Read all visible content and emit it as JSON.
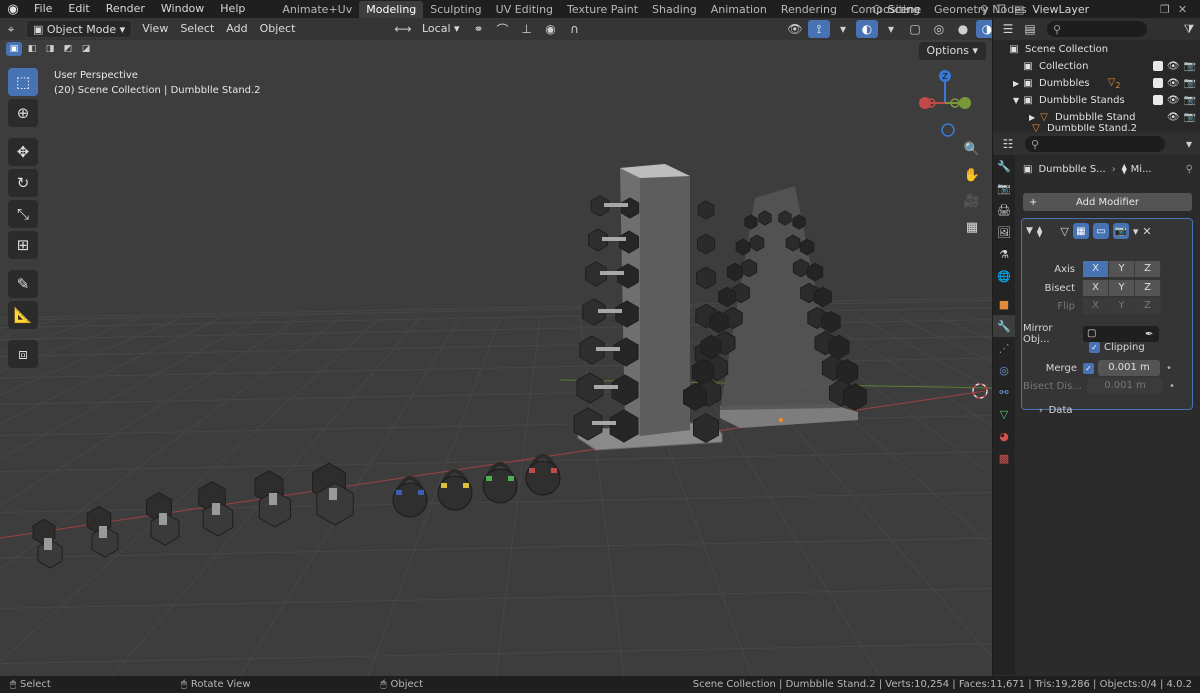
{
  "menu": [
    "File",
    "Edit",
    "Render",
    "Window",
    "Help"
  ],
  "workspaces": [
    {
      "label": "Animate+Uv",
      "active": false
    },
    {
      "label": "Modeling",
      "active": true
    },
    {
      "label": "Sculpting",
      "active": false
    },
    {
      "label": "UV Editing",
      "active": false
    },
    {
      "label": "Texture Paint",
      "active": false
    },
    {
      "label": "Shading",
      "active": false
    },
    {
      "label": "Animation",
      "active": false
    },
    {
      "label": "Rendering",
      "active": false
    },
    {
      "label": "Compositing",
      "active": false
    },
    {
      "label": "Geometry Nodes",
      "active": false
    }
  ],
  "scene_name": "Scene",
  "view_layer": "ViewLayer",
  "viewport": {
    "mode": "Object Mode",
    "menus": [
      "View",
      "Select",
      "Add",
      "Object"
    ],
    "orientation": "Local",
    "options_label": "Options",
    "perspective_label": "User Perspective",
    "collection_label": "(20) Scene Collection | Dumbblle Stand.2",
    "gizmo_z": "Z"
  },
  "outliner": {
    "rows": [
      {
        "label": "Scene Collection",
        "icon": "scene-collection-icon"
      },
      {
        "label": "Collection",
        "icon": "collection-icon"
      },
      {
        "label": "Dumbbles",
        "icon": "collection-icon",
        "badge": "2"
      },
      {
        "label": "Dumbblle Stands",
        "icon": "collection-icon"
      },
      {
        "label": "Dumbblle Stand",
        "icon": "mesh-icon"
      },
      {
        "label": "Dumbblle Stand.2",
        "icon": "mesh-icon"
      }
    ]
  },
  "properties": {
    "object_name": "Dumbblle S...",
    "modifier_crumb": "Mi...",
    "add_modifier": "Add Modifier",
    "axis_label": "Axis",
    "bisect_label": "Bisect",
    "flip_label": "Flip",
    "axes": [
      "X",
      "Y",
      "Z"
    ],
    "mirror_object_label": "Mirror Obj...",
    "clipping_label": "Clipping",
    "merge_label": "Merge",
    "merge_value": "0.001 m",
    "bisect_distance_label": "Bisect Dis...",
    "bisect_distance_value": "0.001 m",
    "data_label": "Data"
  },
  "status": {
    "select": "Select",
    "rotate": "Rotate View",
    "object": "Object",
    "info": "Scene Collection | Dumbblle Stand.2 | Verts:10,254 | Faces:11,671 | Tris:19,286 | Objects:0/4 | 4.0.2"
  },
  "colors": {
    "accent": "#4772b3",
    "viewport_bg": "#3d3d3d",
    "axis_x": "#c44a4a",
    "axis_y": "#7a9a3a",
    "axis_z": "#3a7ad6"
  }
}
